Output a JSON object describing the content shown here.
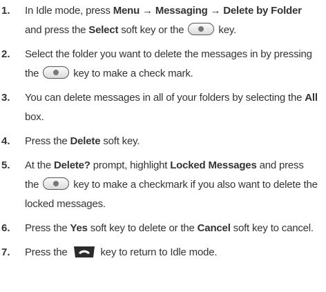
{
  "steps": [
    {
      "num": "1.",
      "parts": [
        {
          "t": "In Idle mode, press "
        },
        {
          "t": "Menu → Messaging → Delete by Folder",
          "b": true
        },
        {
          "t": " and press the "
        },
        {
          "t": "Select",
          "b": true
        },
        {
          "t": " soft key or the "
        },
        {
          "icon": "ok-key-icon"
        },
        {
          "t": " key."
        }
      ]
    },
    {
      "num": "2.",
      "parts": [
        {
          "t": "Select the folder you want to delete the messages in by pressing the "
        },
        {
          "icon": "ok-key-icon"
        },
        {
          "t": " key to make a check mark."
        }
      ]
    },
    {
      "num": "3.",
      "parts": [
        {
          "t": "You can delete messages in all of your folders by selecting the "
        },
        {
          "t": "All",
          "b": true
        },
        {
          "t": " box."
        }
      ]
    },
    {
      "num": "4.",
      "parts": [
        {
          "t": "Press the "
        },
        {
          "t": "Delete",
          "b": true
        },
        {
          "t": " soft key."
        }
      ]
    },
    {
      "num": "5.",
      "parts": [
        {
          "t": "At the "
        },
        {
          "t": "Delete?",
          "b": true
        },
        {
          "t": " prompt, highlight "
        },
        {
          "t": "Locked Messages",
          "b": true
        },
        {
          "t": " and press the "
        },
        {
          "icon": "ok-key-icon"
        },
        {
          "t": " key to make a checkmark if you also want to delete the locked messages."
        }
      ]
    },
    {
      "num": "6.",
      "parts": [
        {
          "t": "Press the "
        },
        {
          "t": "Yes",
          "b": true
        },
        {
          "t": " soft key to delete or the "
        },
        {
          "t": "Cancel",
          "b": true
        },
        {
          "t": " soft key to cancel."
        }
      ]
    },
    {
      "num": "7.",
      "parts": [
        {
          "t": "Press the "
        },
        {
          "icon": "end-key-icon"
        },
        {
          "t": " key to return to Idle mode."
        }
      ]
    }
  ],
  "colors": {
    "text": "#333333",
    "end_key_fill": "#2b2b2b",
    "ok_key_border": "#555555"
  }
}
